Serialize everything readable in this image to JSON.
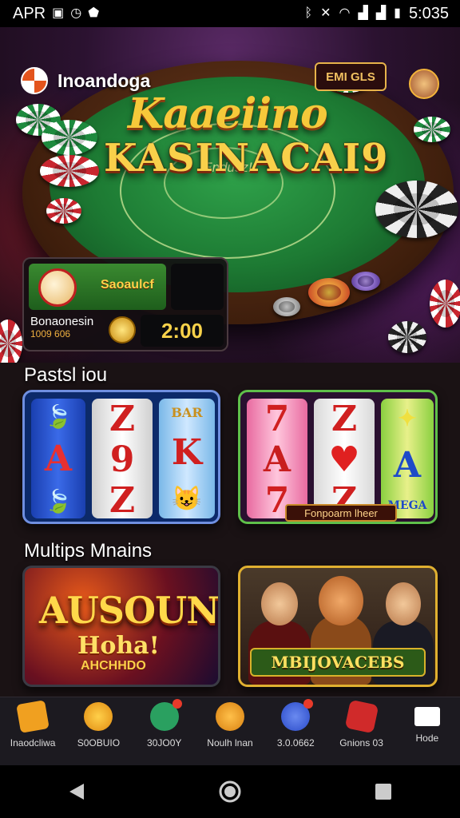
{
  "status_bar": {
    "carrier": "APR",
    "time": "5:035",
    "icons": [
      "image-icon",
      "clock-icon",
      "shield-icon",
      "bluetooth-icon",
      "mute-icon",
      "wifi-icon",
      "signal-icon",
      "signal-icon",
      "battery-icon"
    ]
  },
  "hero": {
    "app_name": "Inoandoga",
    "logo_top": "Kaaeiino",
    "logo_main": "KASINACAI9",
    "felt_label": "Endusz!",
    "corner_sign": "EMI GLS"
  },
  "info_card": {
    "bonus_label": "Saoaulcf",
    "promo_title": "Bonaonesin",
    "promo_sub": "1009 606",
    "timer": "2:00"
  },
  "sections": {
    "slots_title": "Pastsl iou",
    "promos_title": "Multips Mnains"
  },
  "slots": [
    {
      "reels": [
        [
          "🍃",
          "A",
          "🍃"
        ],
        [
          "Z",
          "9",
          "Z"
        ],
        [
          "BAR",
          "K",
          "😺"
        ]
      ]
    },
    {
      "reels": [
        [
          "7",
          "A",
          "7"
        ],
        [
          "Z",
          "♥",
          "Z"
        ],
        [
          "✦",
          "A",
          "MEGA"
        ]
      ],
      "plaque": "Fonpoarm lheer"
    }
  ],
  "promos": [
    {
      "big": "AUSOUN",
      "mid": "Hoha!",
      "small": "AHCHHDO"
    },
    {
      "label": "MBIJOVACEBS"
    }
  ],
  "bottom_nav": [
    {
      "label": "Inaodcliwa",
      "icon": "tag-icon",
      "color": "#f0a020"
    },
    {
      "label": "S0OBUIO",
      "icon": "coin-icon",
      "color": "#f0a020"
    },
    {
      "label": "30JO0Y",
      "icon": "chat-icon",
      "color": "#2aa060",
      "badge": true
    },
    {
      "label": "Noulh lnan",
      "icon": "gamepad-icon",
      "color": "#f0a020"
    },
    {
      "label": "3.0.0662",
      "icon": "globe-icon",
      "color": "#3a5ad8",
      "badge": true
    },
    {
      "label": "Gnions 03",
      "icon": "ticket-icon",
      "color": "#d02a2a"
    },
    {
      "label": "Hode",
      "icon": "mail-icon",
      "color": "#ffffff"
    }
  ],
  "colors": {
    "accent_gold": "#f9d04a",
    "felt_green": "#1d7a33",
    "nav_bg": "#1c1a20"
  }
}
